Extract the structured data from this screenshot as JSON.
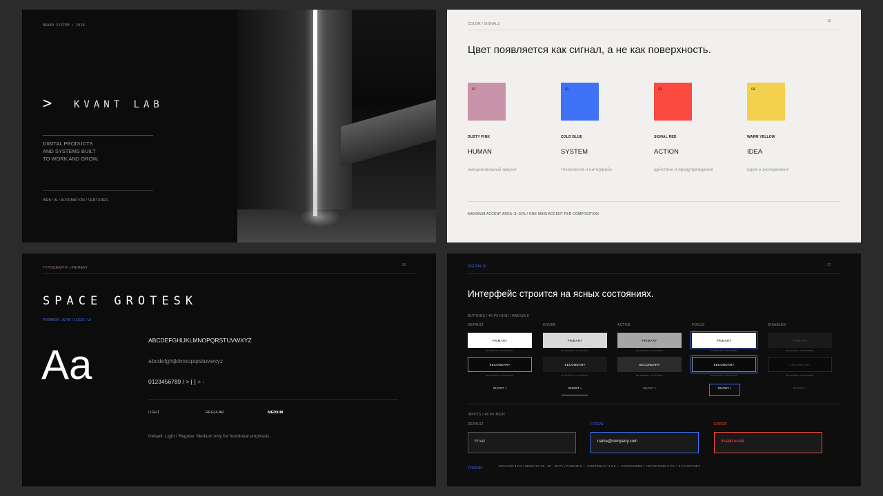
{
  "slide1": {
    "tag": "BRAND SYSTEM / 2026",
    "page": "01",
    "logo_glyph": ">",
    "logo_text": "KVANT LAB",
    "tagline": [
      "DIGITAL PRODUCTS",
      "AND SYSTEMS BUILT",
      "TO WORK AND GROW."
    ],
    "footer": "WEB  /  AI  /  AUTOMATION  /  VENTURES"
  },
  "slide2": {
    "tag": "COLOR / SIGNALS",
    "page": "10",
    "headline": "Цвет появляется как сигнал, а не как поверхность.",
    "colors": [
      {
        "num": "01",
        "hex": "#c994aa",
        "name": "DUSTY PINK",
        "role": "HUMAN",
        "desc": "эмоциональный акцент"
      },
      {
        "num": "02",
        "hex": "#3f72f7",
        "name": "COLD BLUE",
        "role": "SYSTEM",
        "desc": "технология и интерфейс"
      },
      {
        "num": "03",
        "hex": "#fb4a3f",
        "name": "SIGNAL RED",
        "role": "ACTION",
        "desc": "действие и предупреждение"
      },
      {
        "num": "04",
        "hex": "#f3d04e",
        "name": "WARM YELLOW",
        "role": "IDEA",
        "desc": "идея и эксперимент"
      }
    ],
    "footer": "MAXIMUM ACCENT AREA: 8–10%  /  ONE MAIN ACCENT PER COMPOSITION"
  },
  "slide3": {
    "tag": "TYPOGRAPHY / PRIMARY",
    "page": "20",
    "font_name": "SPACE GROTESK",
    "usage": "PRIMARY LATIN / LOGO / UI",
    "specimen": "Aa",
    "uppercase": "ABCDEFGHIJKLMNOPQRSTUVWXYZ",
    "lowercase": "abcdefghijklmnopqrstuvwxyz",
    "digits": "0123456789  /  > [ ] + -",
    "weights": [
      "LIGHT",
      "REGULAR",
      "MEDIUM"
    ],
    "note": "Default: Light / Regular. Medium only for functional emphasis."
  },
  "slide4": {
    "tag": "DIGITAL UI",
    "page": "27",
    "headline": "Интерфейс строится на ясных состояниях.",
    "buttons_label": "BUTTONS / 40 PX HIGH / RADIUS 0",
    "states": [
      "DEFAULT",
      "HOVER",
      "ACTIVE",
      "FOCUS",
      "DISABLED"
    ],
    "primary_label": "PRIMARY",
    "secondary_label": "SECONDARY",
    "ghost_label": "GHOST  +",
    "primary_subs": [
      "BG #FFFFFF / TXT #0A0A0A",
      "BG #D9D9D9 / TXT #0A0A0A",
      "BG #A6A6A6 / TXT #0A0A0A",
      "BG #FFFFFF / TXT #0A0A0A",
      "BG #1A1A1A / TXT #4D4D4D"
    ],
    "secondary_subs": [
      "BG #0A0A0A / TXT #FFFFFF",
      "BG #1A1A1A / TXT #FFFFFF",
      "BG #2B2B2B / TXT #FFFFFF",
      "BG #0A0A0A / TXT #FFFFFF",
      "BG #0A0A0A / TXT #4D4D4D"
    ],
    "inputs_label": "INPUTS / 48 PX HIGH",
    "input_states": [
      "DEFAULT",
      "FOCUS",
      "ERROR"
    ],
    "input_values": [
      "Email",
      "name@company.com",
      "Invalid email"
    ],
    "tokens_label": "TOKENS",
    "tokens": "SPACING 8 PX  /  HEIGHTS 32 · 40 · 48 PX  /  RADIUS 0 — CONTROLS / 4 PX — CONTAINERS  /  FOCUS RING 2 PX + 2 PX OFFSET",
    "accent": "#3f72f7",
    "error": "#fb4a3f"
  }
}
